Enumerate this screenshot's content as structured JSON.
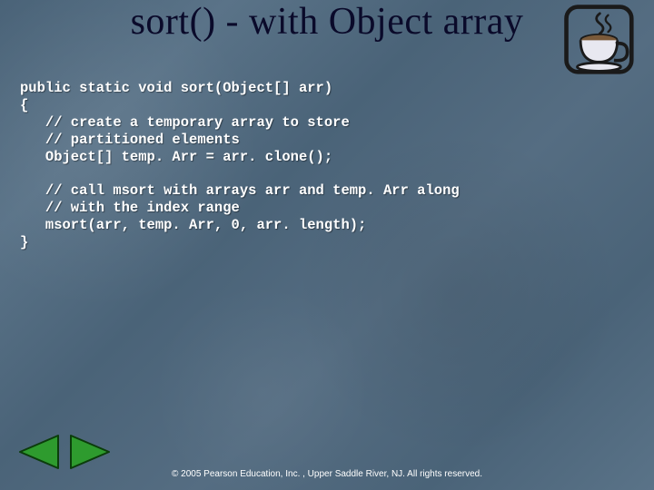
{
  "title": "sort() - with Object array",
  "code_lines": [
    "public static void sort(Object[] arr)",
    "{",
    "   // create a temporary array to store",
    "   // partitioned elements",
    "   Object[] temp. Arr = arr. clone();",
    "",
    "   // call msort with arrays arr and temp. Arr along",
    "   // with the index range",
    "   msort(arr, temp. Arr, 0, arr. length);",
    "}"
  ],
  "footer": "© 2005 Pearson Education, Inc. , Upper Saddle River, NJ.  All rights reserved.",
  "colors": {
    "arrow_fill": "#2e9b2e",
    "arrow_stroke": "#0b3d0b",
    "cup_frame": "#1a1a1a",
    "cup_body": "#e8e8f0",
    "cup_liquid": "#7a5a3a"
  }
}
